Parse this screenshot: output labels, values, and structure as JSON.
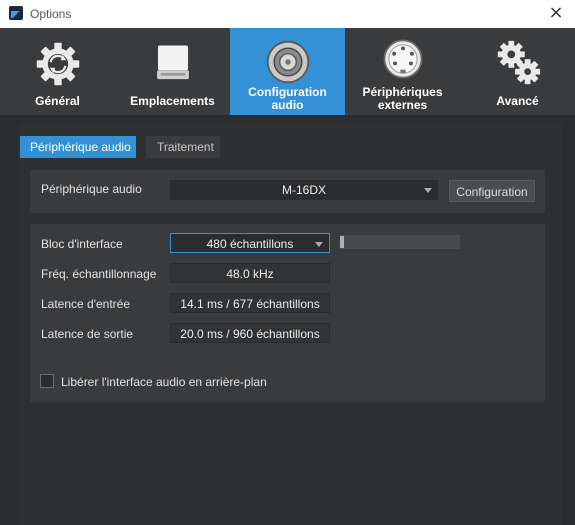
{
  "window": {
    "title": "Options",
    "close_icon": "×"
  },
  "tabs": [
    {
      "label": "Général",
      "icon": "gear-refresh-icon",
      "active": false
    },
    {
      "label": "Emplacements",
      "icon": "drive-icon",
      "active": false
    },
    {
      "label": "Configuration\naudio",
      "icon": "speaker-icon",
      "active": true
    },
    {
      "label": "Périphériques\nexternes",
      "icon": "midi-port-icon",
      "active": false
    },
    {
      "label": "Avancé",
      "icon": "gears-icon",
      "active": false
    }
  ],
  "subtabs": [
    {
      "label": "Périphérique audio",
      "active": true
    },
    {
      "label": "Traitement",
      "active": false
    }
  ],
  "device": {
    "label": "Périphérique audio",
    "value": "M-16DX",
    "config_button": "Configuration"
  },
  "settings": {
    "buffer_label": "Bloc d'interface",
    "buffer_value": "480 échantillons",
    "buffer_meter_level": 0.03,
    "samplerate_label": "Fréq. échantillonnage",
    "samplerate_value": "48.0 kHz",
    "input_latency_label": "Latence d'entrée",
    "input_latency_value": "14.1 ms / 677 échantillons",
    "output_latency_label": "Latence de sortie",
    "output_latency_value": "20.0 ms / 960 échantillons",
    "release_checkbox_label": "Libérer l'interface audio en arrière-plan",
    "release_checked": false
  },
  "colors": {
    "accent": "#3591d6",
    "background": "#2b2c2e",
    "panel": "#3a3b3d"
  }
}
